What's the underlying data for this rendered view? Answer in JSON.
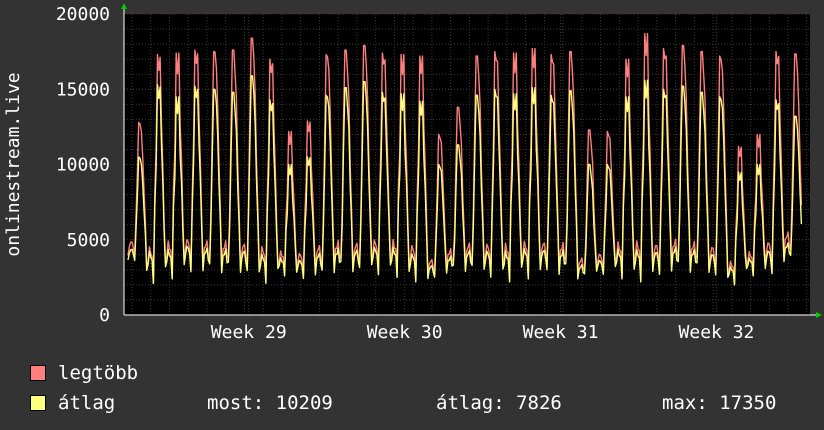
{
  "chart_data": {
    "type": "line",
    "title": "",
    "ylabel": "onlinestream.live",
    "xlabel": "",
    "ylim": [
      0,
      20000
    ],
    "y_ticks": [
      "0",
      "5000",
      "10000",
      "15000",
      "20000"
    ],
    "x_ticks": [
      "Week 29",
      "Week 30",
      "Week 31",
      "Week 32"
    ],
    "x_range_weeks": [
      28.2,
      32.6
    ],
    "grid": true,
    "legend_placement": "bottom-left",
    "series": [
      {
        "name": "legtöbb",
        "color": "#ff7f7f",
        "daily_peaks": [
          12800,
          17300,
          17400,
          17600,
          17500,
          17600,
          18400,
          17000,
          12200,
          12900,
          17300,
          17600,
          17900,
          17400,
          17300,
          17200,
          12000,
          13800,
          17200,
          17500,
          17400,
          17700,
          17300,
          17500,
          12300,
          12200,
          17000,
          18700,
          17700,
          17900,
          17500,
          17200,
          11200,
          12000,
          17500,
          17350
        ],
        "daily_mins": [
          3500,
          2100,
          2500,
          2800,
          2600,
          2500,
          2300,
          2200,
          2700,
          2500,
          2300,
          2500,
          2400,
          2700,
          2600,
          2300,
          2200,
          2600,
          2500,
          2400,
          2300,
          2500,
          2600,
          2400,
          2200,
          2600,
          2500,
          2300,
          2400,
          2600,
          2500,
          2300,
          2100,
          2700,
          2600,
          3300
        ]
      },
      {
        "name": "átlag",
        "color": "#ffff7f",
        "daily_peaks": [
          10500,
          15300,
          14500,
          15200,
          15000,
          14800,
          15900,
          14300,
          10000,
          10500,
          14600,
          15100,
          15500,
          14800,
          14700,
          14200,
          10000,
          11300,
          14600,
          15000,
          14700,
          15100,
          14600,
          14900,
          10000,
          10000,
          14500,
          15600,
          15000,
          15200,
          14800,
          14500,
          9500,
          10000,
          14300,
          13200
        ],
        "daily_mins": [
          3300,
          2100,
          2400,
          2700,
          2500,
          2400,
          2200,
          2100,
          2600,
          2400,
          2200,
          2400,
          2300,
          2600,
          2500,
          2200,
          2100,
          2500,
          2400,
          2300,
          2200,
          2400,
          2500,
          2300,
          2100,
          2500,
          2400,
          2200,
          2300,
          2500,
          2400,
          2200,
          2000,
          2600,
          2500,
          3200
        ]
      }
    ]
  },
  "legend": [
    {
      "label": "legtöbb",
      "color": "#ff7f7f"
    },
    {
      "label": "átlag",
      "color": "#ffff7f"
    }
  ],
  "stats": {
    "most": "most: 10209",
    "atlag": "átlag: 7826",
    "max": "max: 17350"
  },
  "colors": {
    "background": "#333333",
    "plot_background": "#000000",
    "grid_minor": "#3a3a3a",
    "grid_major": "#5a2a2a",
    "axis_arrow": "#00cc00"
  }
}
